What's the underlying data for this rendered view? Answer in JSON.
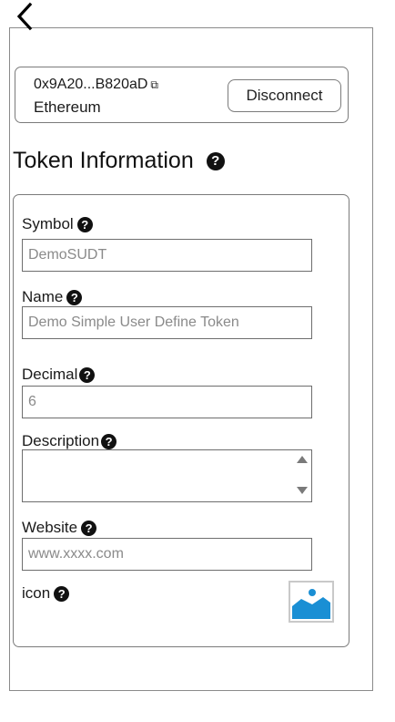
{
  "header": {
    "back_icon": "chevron-left-icon"
  },
  "wallet": {
    "address": "0x9A20...B820aD",
    "copy_icon": "copy-icon",
    "network": "Ethereum",
    "disconnect_label": "Disconnect"
  },
  "section": {
    "title": "Token Information",
    "help_icon": "question-circle-icon"
  },
  "form": {
    "symbol": {
      "label": "Symbol",
      "placeholder": "DemoSUDT"
    },
    "name": {
      "label": "Name",
      "placeholder": "Demo Simple User Define Token"
    },
    "decimal": {
      "label": "Decimal",
      "placeholder": "6"
    },
    "description": {
      "label": "Description"
    },
    "website": {
      "label": "Website",
      "placeholder": "www.xxxx.com"
    },
    "icon": {
      "label": "icon",
      "image_icon": "image-upload-icon"
    }
  },
  "colors": {
    "icon_blue": "#1a8fd4",
    "border": "#7b7b7b",
    "placeholder": "#8a8a8a"
  }
}
